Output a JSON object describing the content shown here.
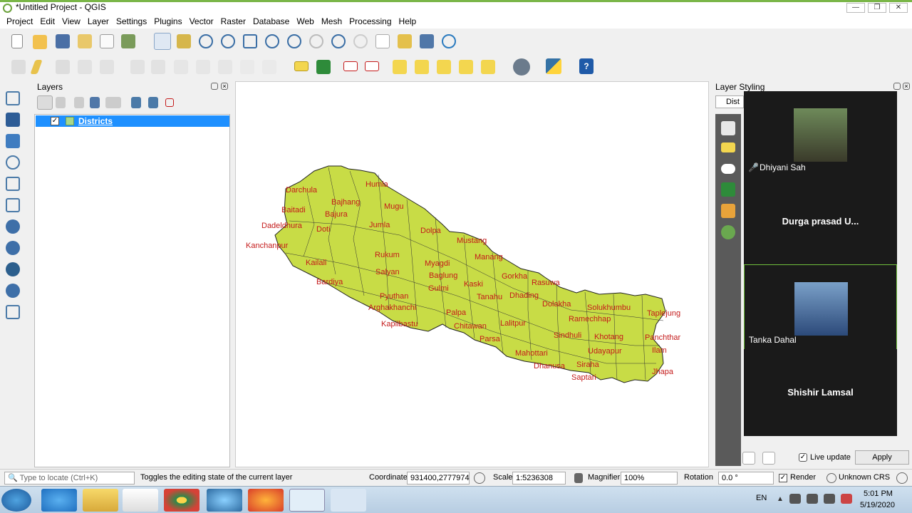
{
  "window": {
    "title": "*Untitled Project - QGIS"
  },
  "menu": [
    "Project",
    "Edit",
    "View",
    "Layer",
    "Settings",
    "Plugins",
    "Vector",
    "Raster",
    "Database",
    "Web",
    "Mesh",
    "Processing",
    "Help"
  ],
  "layers_panel": {
    "title": "Layers",
    "layers": [
      {
        "name": "Districts",
        "checked": true
      }
    ]
  },
  "map": {
    "labels": [
      "Darchula",
      "Humla",
      "Bajhang",
      "Baitadi",
      "Bajura",
      "Mugu",
      "Dadeldhura",
      "Doti",
      "Jumla",
      "Dolpa",
      "Kanchanpur",
      "Mustang",
      "Rukum",
      "Manang",
      "Kailali",
      "Myagdi",
      "Salyan",
      "Baglung",
      "Gorkha",
      "Rasuwa",
      "Bardiya",
      "Gulmi",
      "Kaski",
      "Pyuthan",
      "Tanahu",
      "Dhading",
      "Dolakha",
      "Solukhumbu",
      "Taplejung",
      "Arghakhanchi",
      "Palpa",
      "Ramechhap",
      "Kapilbastu",
      "Chitawan",
      "Lalitpur",
      "Sindhuli",
      "Khotang",
      "Panchthar",
      "Parsa",
      "Udayapur",
      "Ilam",
      "Mahottari",
      "Siraha",
      "Dhanusa",
      "Jhapa",
      "Saptari"
    ],
    "fill_color": "#c8dc46",
    "label_color": "#c41a1a"
  },
  "styling_panel": {
    "title": "Layer Styling",
    "layer_select": "Dist",
    "live_update": "Live update",
    "apply": "Apply"
  },
  "zoom": {
    "participants": [
      {
        "name": "Dhiyani Sah",
        "has_video": true,
        "muted": true
      },
      {
        "name": "Durga prasad U...",
        "has_video": false
      },
      {
        "name": "Tanka Dahal",
        "has_video": true,
        "active": true
      },
      {
        "name": "Shishir Lamsal",
        "has_video": false
      }
    ]
  },
  "statusbar": {
    "locate_placeholder": "Type to locate (Ctrl+K)",
    "message": "Toggles the editing state of the current layer",
    "coordinate_label": "Coordinate",
    "coordinate": "931400,2777974",
    "scale_label": "Scale",
    "scale": "1:5236308",
    "magnifier_label": "Magnifier",
    "magnifier": "100%",
    "rotation_label": "Rotation",
    "rotation": "0.0 °",
    "render": "Render",
    "crs": "Unknown CRS"
  },
  "taskbar": {
    "lang": "EN",
    "time": "5:01 PM",
    "date": "5/19/2020"
  }
}
